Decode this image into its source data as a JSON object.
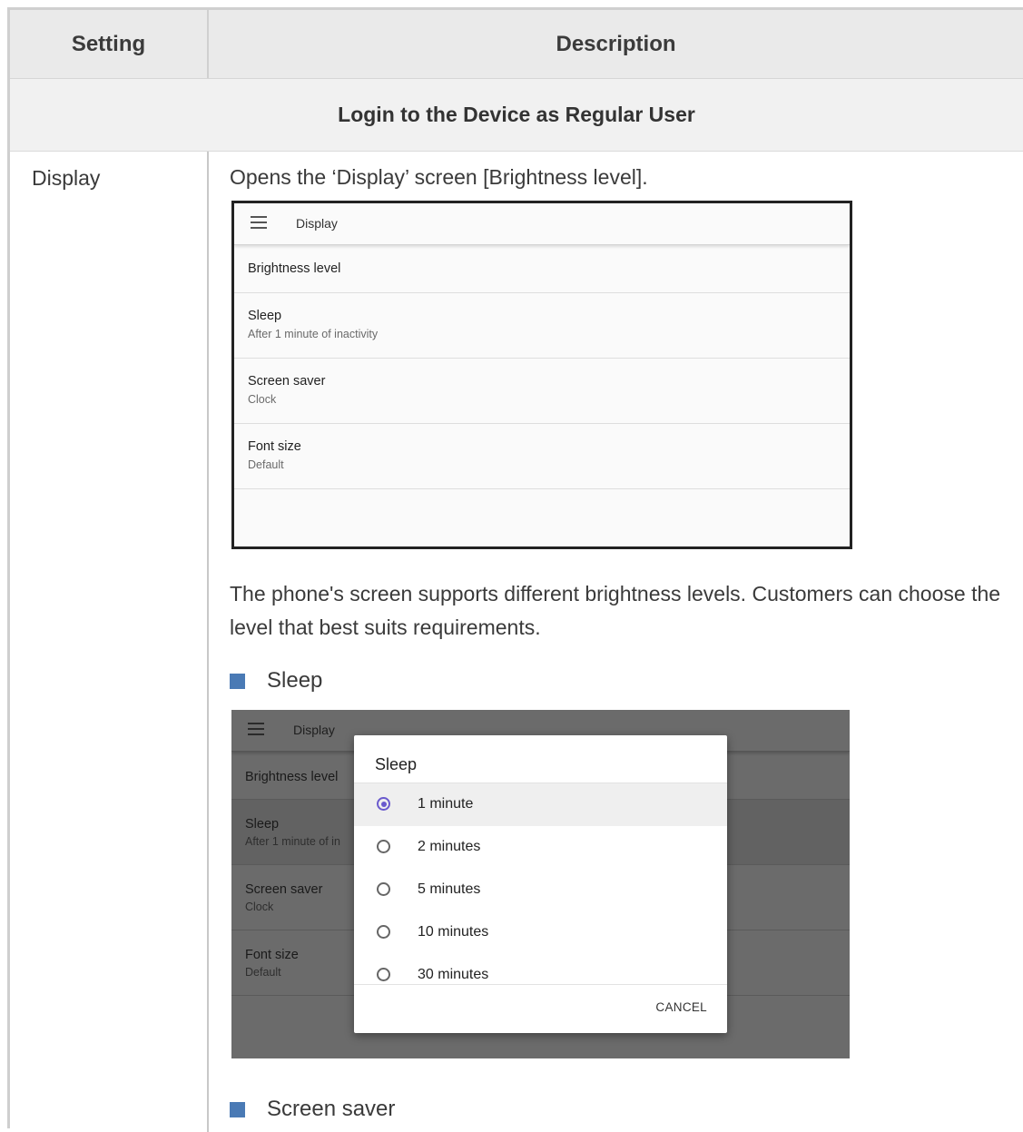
{
  "table": {
    "header_setting": "Setting",
    "header_description": "Description",
    "section_title": "Login to the Device as Regular User",
    "row_setting": "Display",
    "intro": "Opens the ‘Display’ screen [Brightness level].",
    "paragraph": "The phone's screen supports different brightness levels. Customers can choose the level that best suits requirements.",
    "bullet_sleep": "Sleep",
    "bullet_screen_saver": "Screen saver",
    "bullet_color": "#4a7ab5"
  },
  "shot1": {
    "menu_icon": "hamburger-menu-icon",
    "title": "Display",
    "items": [
      {
        "title": "Brightness level",
        "subtitle": ""
      },
      {
        "title": "Sleep",
        "subtitle": "After 1 minute of inactivity"
      },
      {
        "title": "Screen saver",
        "subtitle": "Clock"
      },
      {
        "title": "Font size",
        "subtitle": "Default"
      }
    ]
  },
  "shot2": {
    "menu_icon": "hamburger-menu-icon",
    "title": "Display",
    "items": [
      {
        "title": "Brightness level",
        "subtitle": ""
      },
      {
        "title": "Sleep",
        "subtitle": "After 1 minute of in"
      },
      {
        "title": "Screen saver",
        "subtitle": "Clock"
      },
      {
        "title": "Font size",
        "subtitle": "Default"
      }
    ],
    "dialog": {
      "title": "Sleep",
      "options": [
        "1 minute",
        "2 minutes",
        "5 minutes",
        "10 minutes",
        "30 minutes"
      ],
      "selected": "1 minute",
      "cancel": "CANCEL",
      "accent": "#6a5acd"
    }
  }
}
